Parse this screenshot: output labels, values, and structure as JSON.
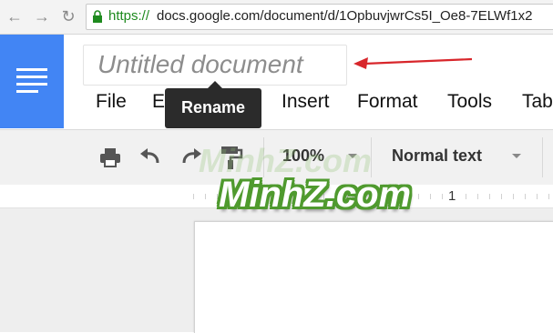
{
  "browser": {
    "url_scheme": "https://",
    "url_rest": "docs.google.com/document/d/1OpbuvjwrCs5I_Oe8-7ELWf1x2"
  },
  "docs": {
    "document_title": "Untitled document",
    "menu": [
      "File",
      "E",
      "Insert",
      "Format",
      "Tools",
      "Tab"
    ],
    "tooltip": "Rename"
  },
  "toolbar": {
    "zoom": "100%",
    "paragraph_style": "Normal text"
  },
  "ruler": {
    "marker": "1"
  },
  "watermark": {
    "text": "MinhZ.com",
    "faint_text": "MinhZ.com"
  },
  "colors": {
    "docs_blue": "#4285f4",
    "annotation_red": "#d8262b",
    "watermark_green": "#4f9a2e",
    "secure_green": "#1e8a1e"
  },
  "icons": [
    "back-icon",
    "forward-icon",
    "reload-icon",
    "lock-icon",
    "docs-logo-icon",
    "print-icon",
    "undo-icon",
    "redo-icon",
    "paint-format-icon",
    "dropdown-caret-icon"
  ]
}
